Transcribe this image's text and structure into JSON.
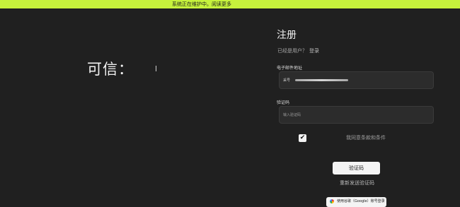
{
  "banner": {
    "text": "系统正在维护中。阅读更多"
  },
  "hero": {
    "text": "可信："
  },
  "form": {
    "title": "注册",
    "login_prompt": "已经是用户？",
    "login_link": "登录",
    "email": {
      "label": "电子邮件地址",
      "value": "采号"
    },
    "code": {
      "label": "验证码",
      "placeholder": "输入验证码"
    },
    "agree_text": "我同意条款和条件",
    "submit_label": "验证码",
    "resend_label": "重新发送验证码",
    "google_label": "使用谷歌（Google）账号登录"
  }
}
